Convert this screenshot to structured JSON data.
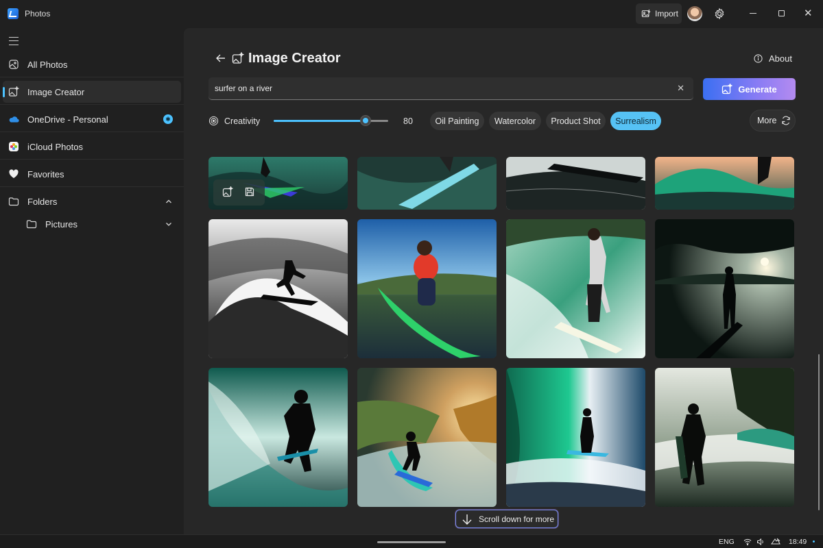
{
  "window": {
    "app_title": "Photos",
    "import_label": "Import"
  },
  "sidebar": {
    "items": [
      {
        "label": "All Photos",
        "icon": "all-photos-icon"
      },
      {
        "label": "Image Creator",
        "icon": "image-creator-icon",
        "active": true
      },
      {
        "label": "OneDrive - Personal",
        "icon": "onedrive-icon"
      },
      {
        "label": "iCloud Photos",
        "icon": "icloud-photos-icon"
      },
      {
        "label": "Favorites",
        "icon": "heart-icon"
      },
      {
        "label": "Folders",
        "icon": "folder-icon",
        "expanded": true
      },
      {
        "label": "Pictures",
        "icon": "folder-icon",
        "expanded": false
      }
    ]
  },
  "header": {
    "title": "Image Creator",
    "about_label": "About"
  },
  "prompt": {
    "value": "surfer on a river",
    "generate_label": "Generate"
  },
  "creativity": {
    "label": "Creativity",
    "value": 80,
    "value_text": "80",
    "max": 100
  },
  "styles": {
    "chips": [
      {
        "label": "Oil Painting",
        "selected": false
      },
      {
        "label": "Watercolor",
        "selected": false
      },
      {
        "label": "Product Shot",
        "selected": false
      },
      {
        "label": "Surrealism",
        "selected": true
      }
    ],
    "more_label": "More"
  },
  "gallery": {
    "scroll_hint": "Scroll down for more",
    "image_count_visible": 12
  },
  "taskbar": {
    "language": "ENG",
    "time": "18:49"
  },
  "colors": {
    "accent": "#4cc2ff",
    "generate_start": "#3b6ff2",
    "generate_end": "#b48bf0",
    "background": "#202020",
    "panel": "#272727"
  }
}
